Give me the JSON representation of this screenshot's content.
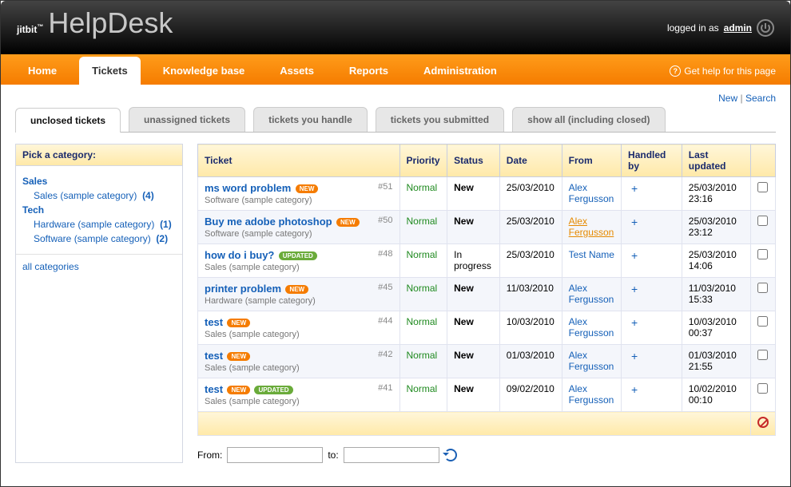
{
  "header": {
    "brand": "jitbit",
    "app_name": "HelpDesk",
    "login_text": "logged in as",
    "username": "admin"
  },
  "nav": {
    "tabs": [
      {
        "label": "Home",
        "active": false
      },
      {
        "label": "Tickets",
        "active": true
      },
      {
        "label": "Knowledge base",
        "active": false
      },
      {
        "label": "Assets",
        "active": false
      },
      {
        "label": "Reports",
        "active": false
      },
      {
        "label": "Administration",
        "active": false
      }
    ],
    "help_label": "Get help for this page"
  },
  "toplinks": {
    "new": "New",
    "sep": "|",
    "search": "Search"
  },
  "subtabs": [
    {
      "label": "unclosed tickets",
      "active": true
    },
    {
      "label": "unassigned tickets",
      "active": false
    },
    {
      "label": "tickets you handle",
      "active": false
    },
    {
      "label": "tickets you submitted",
      "active": false
    },
    {
      "label": "show all (including closed)",
      "active": false
    }
  ],
  "sidebar": {
    "heading": "Pick a category:",
    "cats": [
      {
        "name": "Sales",
        "subs": [
          {
            "name": "Sales (sample category)",
            "count": "(4)"
          }
        ]
      },
      {
        "name": "Tech",
        "subs": [
          {
            "name": "Hardware (sample category)",
            "count": "(1)"
          },
          {
            "name": "Software (sample category)",
            "count": "(2)"
          }
        ]
      }
    ],
    "all": "all categories"
  },
  "columns": {
    "ticket": "Ticket",
    "priority": "Priority",
    "status": "Status",
    "date": "Date",
    "from": "From",
    "handled": "Handled by",
    "updated": "Last updated"
  },
  "rows": [
    {
      "title": "ms word problem",
      "badges": [
        "new"
      ],
      "cat": "Software (sample category)",
      "id": "#51",
      "priority": "Normal",
      "status": "New",
      "status_bold": true,
      "date": "25/03/2010",
      "from": "Alex Fergusson",
      "from_hl": false,
      "handled": "+",
      "updated": "25/03/2010 23:16"
    },
    {
      "title": "Buy me adobe photoshop",
      "badges": [
        "new"
      ],
      "cat": "Software (sample category)",
      "id": "#50",
      "priority": "Normal",
      "status": "New",
      "status_bold": true,
      "date": "25/03/2010",
      "from": "Alex Fergusson",
      "from_hl": true,
      "handled": "+",
      "updated": "25/03/2010 23:12"
    },
    {
      "title": "how do i buy?",
      "badges": [
        "updated"
      ],
      "cat": "Sales (sample category)",
      "id": "#48",
      "priority": "Normal",
      "status": "In progress",
      "status_bold": false,
      "date": "25/03/2010",
      "from": "Test Name",
      "from_hl": false,
      "handled": "+",
      "updated": "25/03/2010 14:06"
    },
    {
      "title": "printer problem",
      "badges": [
        "new"
      ],
      "cat": "Hardware (sample category)",
      "id": "#45",
      "priority": "Normal",
      "status": "New",
      "status_bold": true,
      "date": "11/03/2010",
      "from": "Alex Fergusson",
      "from_hl": false,
      "handled": "+",
      "updated": "11/03/2010 15:33"
    },
    {
      "title": "test",
      "badges": [
        "new"
      ],
      "cat": "Sales (sample category)",
      "id": "#44",
      "priority": "Normal",
      "status": "New",
      "status_bold": true,
      "date": "10/03/2010",
      "from": "Alex Fergusson",
      "from_hl": false,
      "handled": "+",
      "updated": "10/03/2010 00:37"
    },
    {
      "title": "test",
      "badges": [
        "new"
      ],
      "cat": "Sales (sample category)",
      "id": "#42",
      "priority": "Normal",
      "status": "New",
      "status_bold": true,
      "date": "01/03/2010",
      "from": "Alex Fergusson",
      "from_hl": false,
      "handled": "+",
      "updated": "01/03/2010 21:55"
    },
    {
      "title": "test",
      "badges": [
        "new",
        "updated"
      ],
      "cat": "Sales (sample category)",
      "id": "#41",
      "priority": "Normal",
      "status": "New",
      "status_bold": true,
      "date": "09/02/2010",
      "from": "Alex Fergusson",
      "from_hl": false,
      "handled": "+",
      "updated": "10/02/2010 00:10"
    }
  ],
  "filter": {
    "from": "From:",
    "to": "to:"
  }
}
